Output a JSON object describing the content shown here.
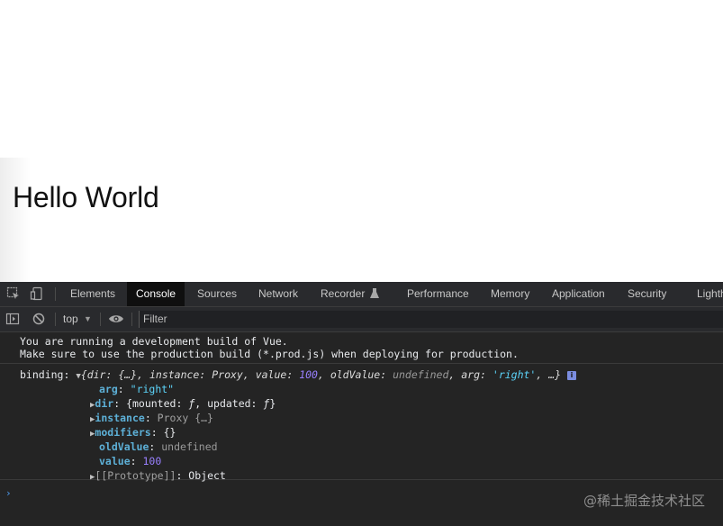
{
  "page": {
    "heading": "Hello World"
  },
  "devtools": {
    "tabs": [
      "Elements",
      "Console",
      "Sources",
      "Network",
      "Recorder",
      "Performance",
      "Memory",
      "Application",
      "Security",
      "Lighth"
    ],
    "active_tab": "Console",
    "toolbar": {
      "context": "top",
      "filter_placeholder": "Filter"
    },
    "console": {
      "warn_line1": "You are running a development build of Vue.",
      "warn_line2": "Make sure to use the production build (*.prod.js) when deploying for production.",
      "log_label": "binding:",
      "summary": {
        "dir_key": "dir",
        "dir_val": "{…}",
        "instance_key": "instance",
        "instance_val": "Proxy",
        "value_key": "value",
        "value_val": "100",
        "oldValue_key": "oldValue",
        "oldValue_val": "undefined",
        "arg_key": "arg",
        "arg_val": "'right'",
        "ellipsis": "…"
      },
      "props": {
        "arg_key": "arg",
        "arg_val": "\"right\"",
        "dir_key": "dir",
        "dir_val_open": "{mounted: ",
        "dir_f1": "ƒ",
        "dir_mid": ", updated: ",
        "dir_f2": "ƒ",
        "dir_close": "}",
        "instance_key": "instance",
        "instance_val": "Proxy {…}",
        "modifiers_key": "modifiers",
        "modifiers_val": "{}",
        "oldValue_key": "oldValue",
        "oldValue_val": "undefined",
        "value_key": "value",
        "value_val": "100",
        "prototype_key": "[[Prototype]]",
        "prototype_val": "Object"
      }
    }
  },
  "watermark": "@稀土掘金技术社区",
  "colors": {
    "devtools_bg": "#242424",
    "number": "#9980ff",
    "string": "#5cd5fb",
    "property": "#5db0d7"
  }
}
